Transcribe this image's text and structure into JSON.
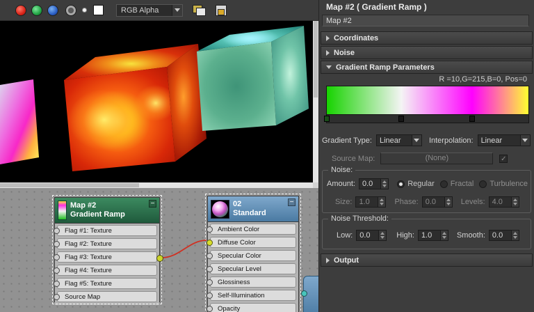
{
  "toolbar": {
    "channel_select_value": "RGB Alpha",
    "icons": [
      "red-channel-toggle",
      "green-channel-toggle",
      "blue-channel-toggle",
      "monochrome-toggle",
      "alpha-indicator",
      "color-swatch",
      "channel-dropdown-arrow",
      "clone-window",
      "save-image"
    ]
  },
  "viewport": {
    "background": "#000000"
  },
  "right_panel": {
    "title": "Map #2  ( Gradient Ramp )",
    "name_value": "Map #2",
    "rollouts": {
      "coordinates": "Coordinates",
      "noise": "Noise",
      "gradient_ramp_parameters": "Gradient Ramp Parameters",
      "output": "Output"
    },
    "flag_info": "R =10,G=215,B=0, Pos=0",
    "gradient": {
      "stops": [
        {
          "pos": 0,
          "color": "#17d300"
        },
        {
          "pos": 37,
          "color": "#f4f4f4"
        },
        {
          "pos": 72,
          "color": "#ff00ff"
        },
        {
          "pos": 100,
          "color": "#ffff30"
        }
      ],
      "flag_positions": [
        0,
        37,
        72
      ]
    },
    "gradient_type_label": "Gradient Type:",
    "gradient_type_value": "Linear",
    "interpolation_label": "Interpolation:",
    "interpolation_value": "Linear",
    "source_map_label": "Source Map:",
    "source_map_value": "(None)",
    "source_map_checkbox_glyph": "✓",
    "noise": {
      "group_label": "Noise:",
      "amount_label": "Amount:",
      "amount_value": "0.0",
      "regular_label": "Regular",
      "fractal_label": "Fractal",
      "turbulence_label": "Turbulence",
      "size_label": "Size:",
      "size_value": "1.0",
      "phase_label": "Phase:",
      "phase_value": "0.0",
      "levels_label": "Levels:",
      "levels_value": "4.0"
    },
    "noise_threshold": {
      "group_label": "Noise Threshold:",
      "low_label": "Low:",
      "low_value": "0.0",
      "high_label": "High:",
      "high_value": "1.0",
      "smooth_label": "Smooth:",
      "smooth_value": "0.0"
    }
  },
  "node_view": {
    "gradient_node": {
      "title": "Map #2",
      "subtitle": "Gradient Ramp",
      "collapse_glyph": "−",
      "slots": [
        "Flag #1: Texture",
        "Flag #2: Texture",
        "Flag #3: Texture",
        "Flag #4: Texture",
        "Flag #5: Texture",
        "Source Map"
      ]
    },
    "standard_node": {
      "title": "02",
      "subtitle": "Standard",
      "collapse_glyph": "−",
      "slots": [
        "Ambient Color",
        "Diffuse Color",
        "Specular Color",
        "Specular Level",
        "Glossiness",
        "Self-Illumination",
        "Opacity"
      ]
    },
    "wire_color": "#d03022"
  },
  "colors": {
    "panel_background": "#3d3d3d",
    "gradient_node_header": "#2e7a52",
    "standard_node_header": "#5e8fb8",
    "selected_flag_color": "#17d300"
  }
}
